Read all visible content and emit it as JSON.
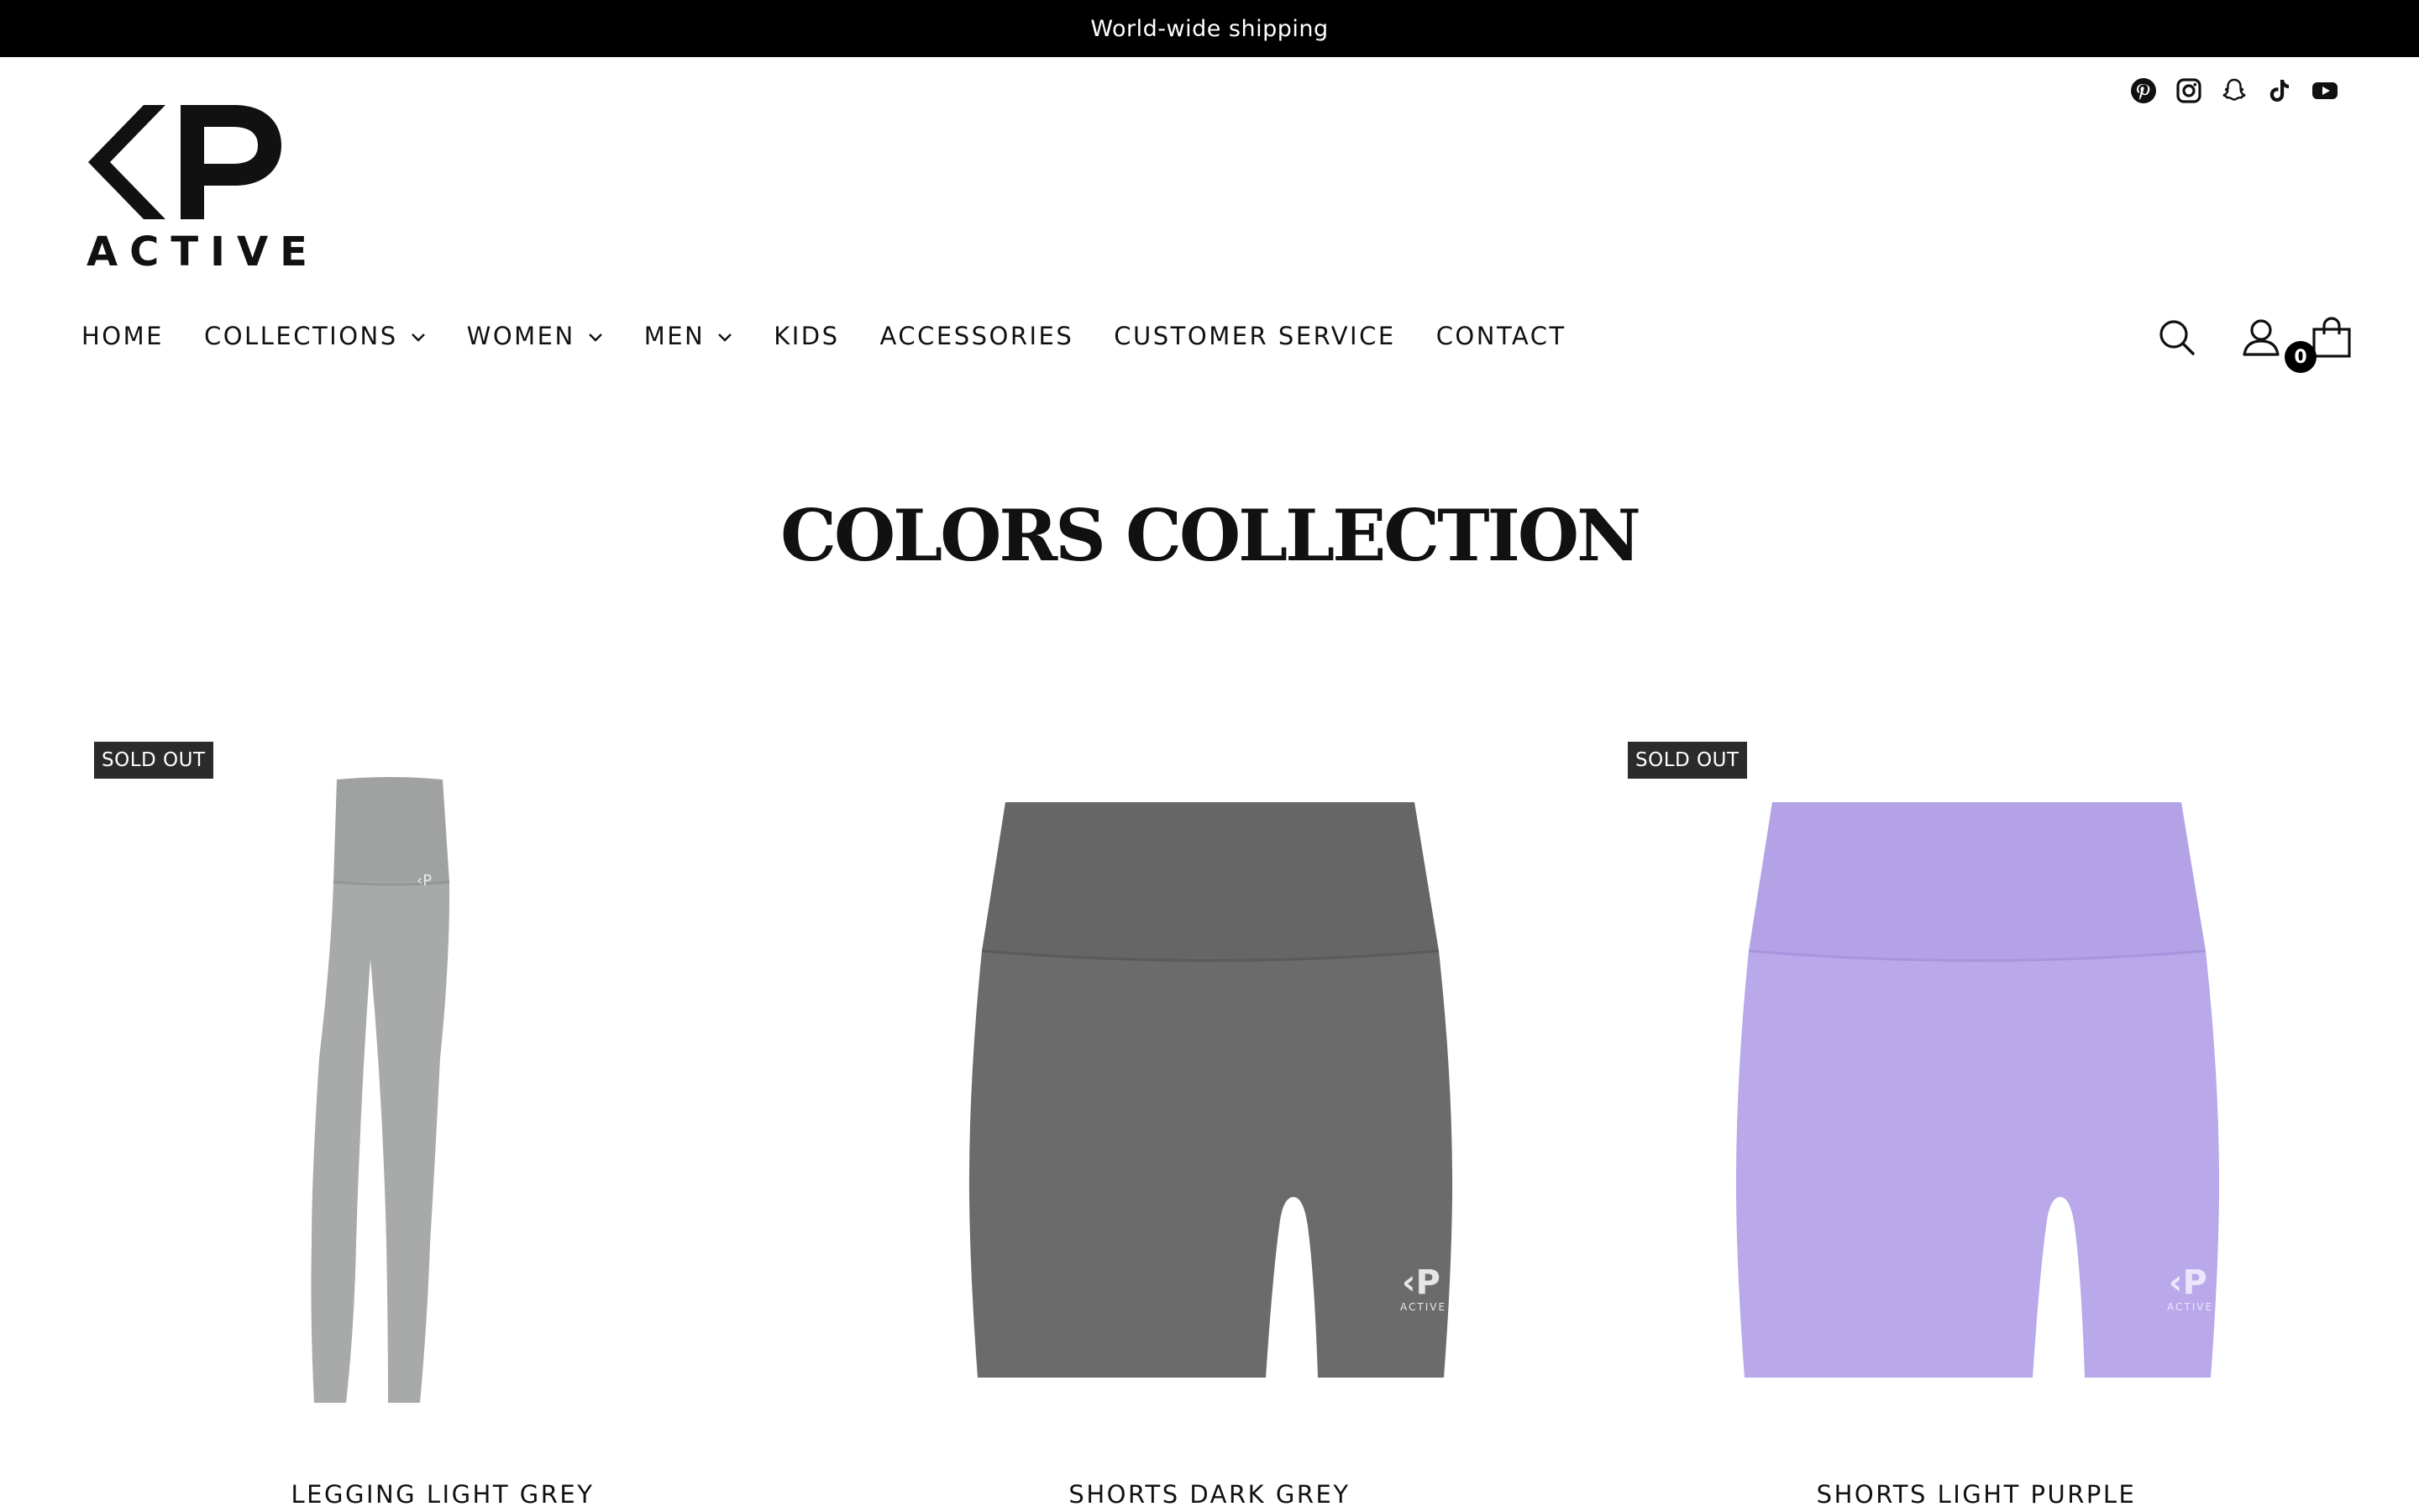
{
  "announcement": {
    "text": "World-wide shipping"
  },
  "brand": {
    "wordmark": "ACTIVE",
    "monogram": "KP"
  },
  "socials": [
    {
      "icon": "pinterest-icon"
    },
    {
      "icon": "instagram-icon"
    },
    {
      "icon": "snapchat-icon"
    },
    {
      "icon": "tiktok-icon"
    },
    {
      "icon": "youtube-icon"
    }
  ],
  "nav": {
    "items": [
      {
        "label": "HOME",
        "has_dropdown": false
      },
      {
        "label": "COLLECTIONS",
        "has_dropdown": true
      },
      {
        "label": "WOMEN",
        "has_dropdown": true
      },
      {
        "label": "MEN",
        "has_dropdown": true
      },
      {
        "label": "KIDS",
        "has_dropdown": false
      },
      {
        "label": "ACCESSORIES",
        "has_dropdown": false
      },
      {
        "label": "CUSTOMER SERVICE",
        "has_dropdown": false
      },
      {
        "label": "CONTACT",
        "has_dropdown": false
      }
    ]
  },
  "header_icons": {
    "search": "search-icon",
    "account": "account-icon",
    "cart": "cart-icon"
  },
  "cart": {
    "count": "0"
  },
  "page": {
    "title": "COLORS COLLECTION"
  },
  "products": [
    {
      "title": "LEGGING LIGHT GREY",
      "badge": "SOLD OUT",
      "color": "#a7aaa9",
      "type": "legging"
    },
    {
      "title": "SHORTS DARK GREY",
      "badge": "",
      "color": "#6b6b6b",
      "type": "shorts"
    },
    {
      "title": "SHORTS LIGHT PURPLE",
      "badge": "SOLD OUT",
      "color": "#b9a8ea",
      "type": "shorts"
    }
  ],
  "colors": {
    "announcement_bg": "#000000",
    "badge_bg": "#2b2b2b",
    "text": "#111111"
  }
}
